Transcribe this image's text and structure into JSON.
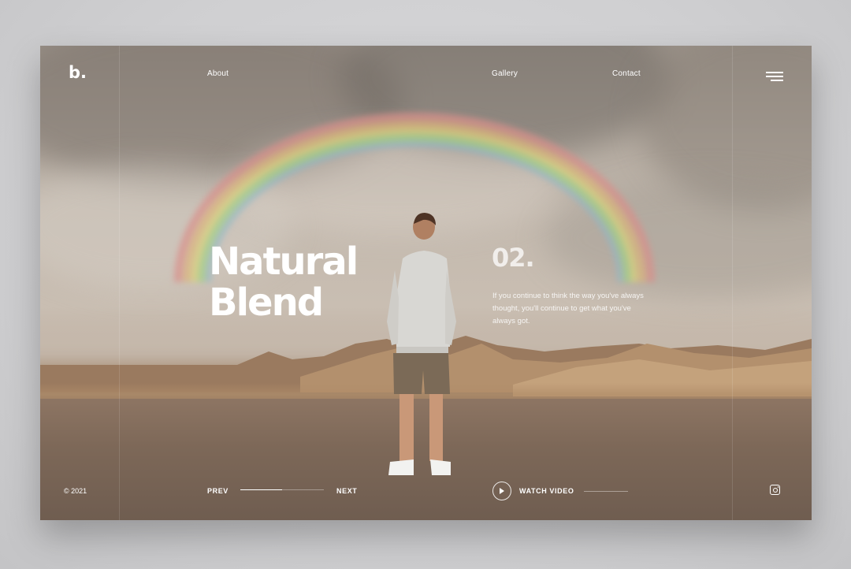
{
  "brand": {
    "logo": "b."
  },
  "nav": {
    "about": "About",
    "gallery": "Gallery",
    "contact": "Contact"
  },
  "hero": {
    "title_line1": "Natural",
    "title_line2": "Blend",
    "slide_number": "02.",
    "description": "If you continue to think the way you've always thought, you'll continue to get what you've always got."
  },
  "footer": {
    "copyright": "© 2021",
    "prev_label": "PREV",
    "next_label": "NEXT",
    "slider_progress": 0.5,
    "watch_video_label": "WATCH VIDEO"
  },
  "icons": {
    "menu": "hamburger-menu-icon",
    "play": "play-icon",
    "social": "instagram-icon"
  },
  "colors": {
    "text": "#ffffff",
    "background": "#d0d0d2"
  }
}
